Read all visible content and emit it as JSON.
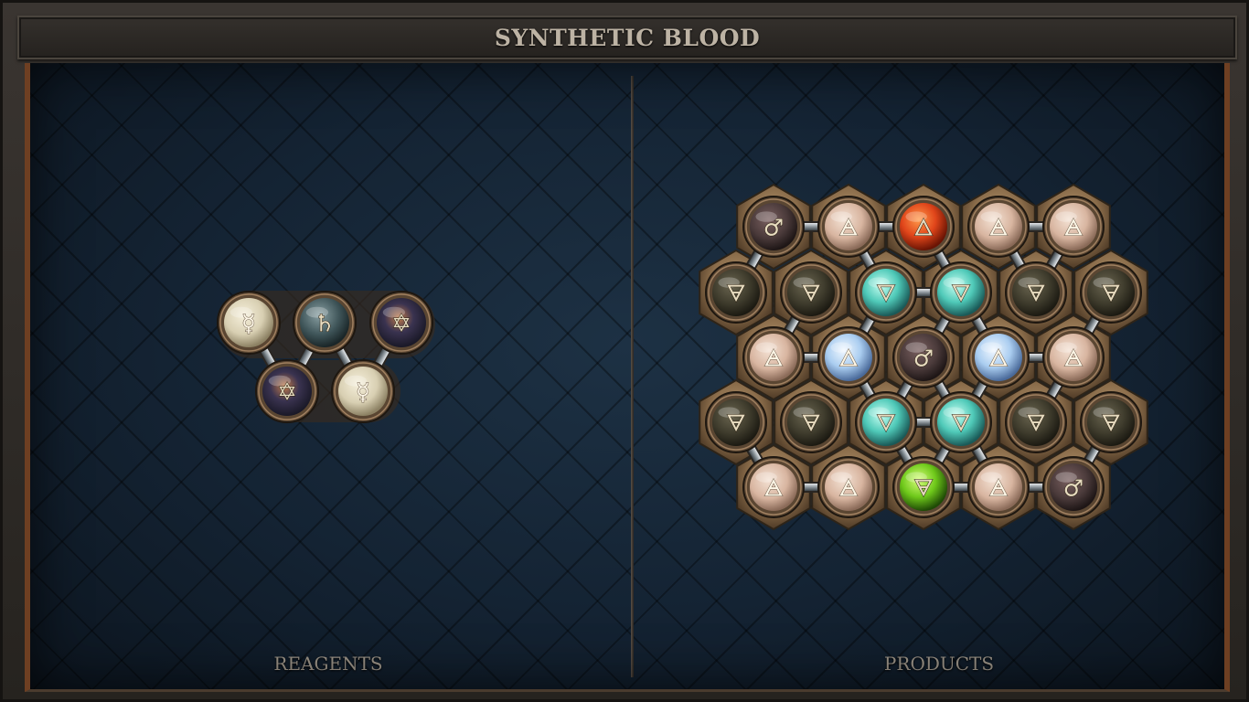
{
  "title": "SYNTHETIC BLOOD",
  "panels": {
    "reagents_label": "REAGENTS",
    "products_label": "PRODUCTS"
  },
  "colors": {
    "bone": "#d8cfb2",
    "slate": "#40565a",
    "cosmic": "#2a2a3a",
    "flesh": "#d8b5a0",
    "dark": "#3e3b2c",
    "teal": "#4fc9b8",
    "mist": "#aacdf0",
    "mars": "#4a3a3a",
    "fire": "#e0451a",
    "green": "#6ec81a",
    "text_gold": "#e8dcc0",
    "text_dark": "#c9b37a"
  },
  "reagents": {
    "atoms": [
      {
        "symbol": "☿",
        "element": "quicksilver",
        "style": "bone"
      },
      {
        "symbol": "♄",
        "element": "salt",
        "style": "slate"
      },
      {
        "symbol": "✡",
        "element": "vitae",
        "style": "cosmic"
      },
      {
        "symbol": "✡",
        "element": "vitae",
        "style": "cosmic"
      },
      {
        "symbol": "☿",
        "element": "quicksilver",
        "style": "bone"
      }
    ]
  },
  "products": {
    "atoms": [
      {
        "symbol": "♂",
        "element": "iron",
        "style": "mars"
      },
      {
        "symbol": "🜁",
        "element": "air",
        "style": "flesh"
      },
      {
        "symbol": "🜂",
        "element": "fire",
        "style": "fire"
      },
      {
        "symbol": "🜁",
        "element": "air",
        "style": "flesh"
      },
      {
        "symbol": "🜁",
        "element": "air",
        "style": "flesh"
      },
      {
        "symbol": "🜃",
        "element": "earth",
        "style": "dark"
      },
      {
        "symbol": "🜃",
        "element": "earth",
        "style": "dark"
      },
      {
        "symbol": "🜄",
        "element": "water",
        "style": "teal"
      },
      {
        "symbol": "🜄",
        "element": "water",
        "style": "teal"
      },
      {
        "symbol": "🜃",
        "element": "earth",
        "style": "dark"
      },
      {
        "symbol": "🜃",
        "element": "earth",
        "style": "dark"
      },
      {
        "symbol": "🜁",
        "element": "air",
        "style": "flesh"
      },
      {
        "symbol": "🜂",
        "element": "fire",
        "style": "mist"
      },
      {
        "symbol": "♂",
        "element": "iron",
        "style": "mars"
      },
      {
        "symbol": "🜂",
        "element": "fire",
        "style": "mist"
      },
      {
        "symbol": "🜁",
        "element": "air",
        "style": "flesh"
      },
      {
        "symbol": "🜃",
        "element": "earth",
        "style": "dark"
      },
      {
        "symbol": "🜃",
        "element": "earth",
        "style": "dark"
      },
      {
        "symbol": "🜄",
        "element": "water",
        "style": "teal"
      },
      {
        "symbol": "🜄",
        "element": "water",
        "style": "teal"
      },
      {
        "symbol": "🜃",
        "element": "earth",
        "style": "dark"
      },
      {
        "symbol": "🜃",
        "element": "earth",
        "style": "dark"
      },
      {
        "symbol": "🜁",
        "element": "air",
        "style": "flesh"
      },
      {
        "symbol": "🜁",
        "element": "air",
        "style": "flesh"
      },
      {
        "symbol": "🜃",
        "element": "earth",
        "style": "green"
      },
      {
        "symbol": "🜁",
        "element": "air",
        "style": "flesh"
      },
      {
        "symbol": "♂",
        "element": "iron",
        "style": "mars"
      }
    ]
  }
}
